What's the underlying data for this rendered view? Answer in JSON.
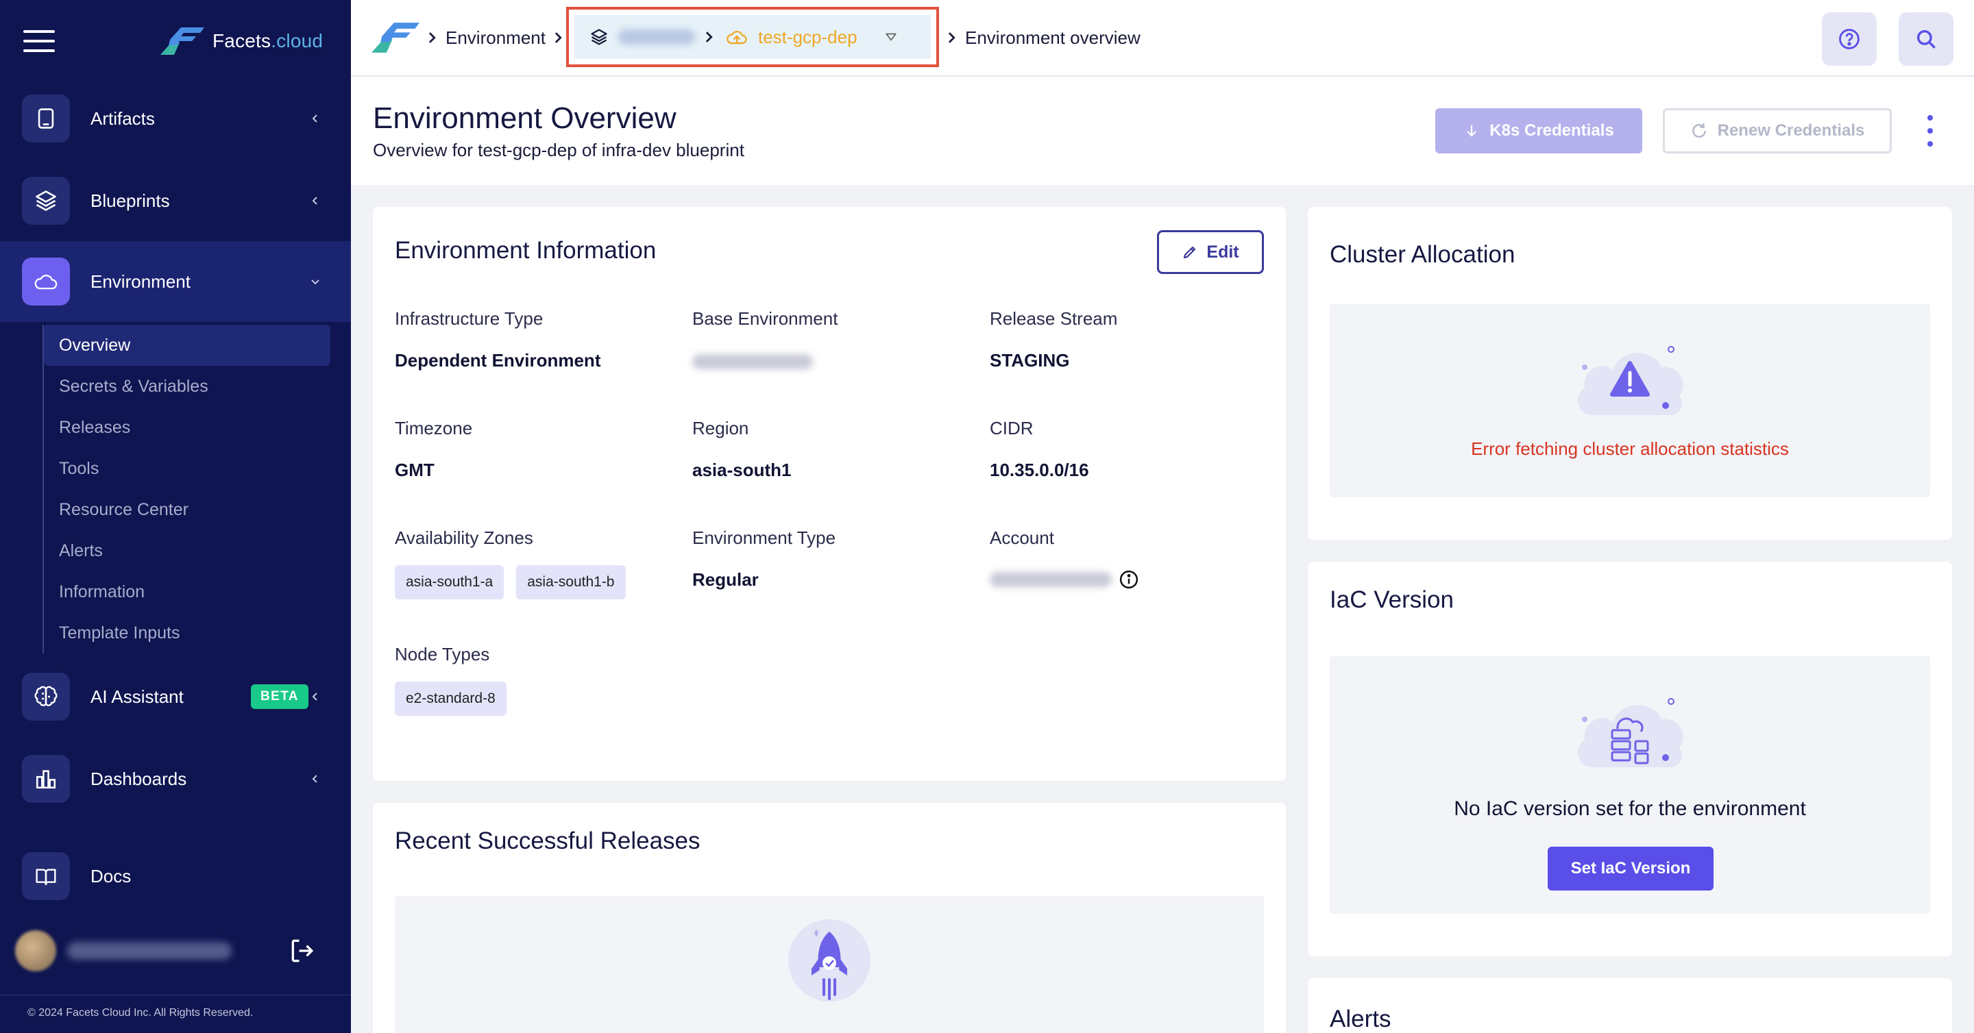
{
  "brand": {
    "name_main": "Facets",
    "name_accent": ".cloud"
  },
  "sidebar": {
    "items": [
      {
        "label": "Artifacts",
        "icon": "tablet-icon"
      },
      {
        "label": "Blueprints",
        "icon": "layers-icon"
      },
      {
        "label": "Environment",
        "icon": "cloud-icon"
      },
      {
        "label": "AI Assistant",
        "icon": "brain-icon",
        "badge": "BETA"
      },
      {
        "label": "Dashboards",
        "icon": "bar-chart-icon"
      },
      {
        "label": "Docs",
        "icon": "book-icon"
      }
    ],
    "subitems": [
      "Overview",
      "Secrets & Variables",
      "Releases",
      "Tools",
      "Resource Center",
      "Alerts",
      "Information",
      "Template Inputs"
    ],
    "copyright": "© 2024 Facets Cloud Inc. All Rights Reserved."
  },
  "breadcrumb": {
    "environment": "Environment",
    "env_name": "test-gcp-dep",
    "current": "Environment overview"
  },
  "page": {
    "title": "Environment Overview",
    "subtitle": "Overview for test-gcp-dep of infra-dev blueprint",
    "k8s_button": "K8s Credentials",
    "renew_button": "Renew Credentials"
  },
  "env_info": {
    "title": "Environment Information",
    "edit_label": "Edit",
    "infra_type_label": "Infrastructure Type",
    "infra_type_value": "Dependent Environment",
    "base_env_label": "Base Environment",
    "release_stream_label": "Release Stream",
    "release_stream_value": "STAGING",
    "timezone_label": "Timezone",
    "timezone_value": "GMT",
    "region_label": "Region",
    "region_value": "asia-south1",
    "cidr_label": "CIDR",
    "cidr_value": "10.35.0.0/16",
    "az_label": "Availability Zones",
    "az_values": [
      "asia-south1-a",
      "asia-south1-b"
    ],
    "env_type_label": "Environment Type",
    "env_type_value": "Regular",
    "account_label": "Account",
    "node_types_label": "Node Types",
    "node_types_values": [
      "e2-standard-8"
    ]
  },
  "releases": {
    "title": "Recent Successful Releases"
  },
  "cluster": {
    "title": "Cluster Allocation",
    "error": "Error fetching cluster allocation statistics"
  },
  "iac": {
    "title": "IaC Version",
    "message": "No IaC version set for the environment",
    "button": "Set IaC Version"
  },
  "alerts": {
    "title": "Alerts"
  },
  "colors": {
    "sidebar_bg": "#0e1550",
    "accent": "#5a4ee8",
    "env_name": "#f0a726",
    "error": "#d7341f",
    "highlight_border": "#e2513b"
  }
}
